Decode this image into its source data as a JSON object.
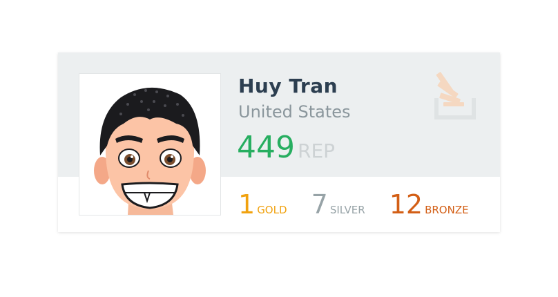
{
  "profile": {
    "name": "Huy Tran",
    "location": "United States",
    "reputation": "449",
    "reputation_label": "REP"
  },
  "badges": {
    "gold": {
      "count": "1",
      "label": "GOLD",
      "color": "#f1a20f"
    },
    "silver": {
      "count": "7",
      "label": "SILVER",
      "color": "#97a3a7"
    },
    "bronze": {
      "count": "12",
      "label": "BRONZE",
      "color": "#d35f16"
    }
  },
  "icons": {
    "logo": "stack-overflow-logo-icon",
    "avatar": "cartoon-avatar"
  },
  "colors": {
    "reputation": "#27ae60",
    "name": "#2c3e50",
    "location": "#8a969c",
    "card_top_bg": "#eceff0"
  }
}
